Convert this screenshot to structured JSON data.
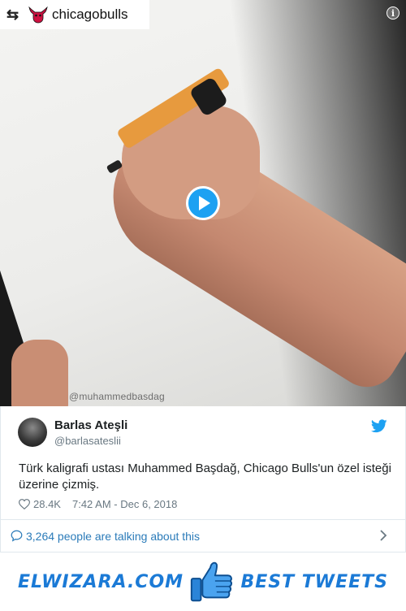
{
  "repost": {
    "account": "chicagobulls",
    "repost_icon": "retweet-icon",
    "logo_icon": "bull-logo-icon"
  },
  "media": {
    "watermark": "@muhammedbasdag",
    "play_icon": "play-icon",
    "info_icon": "info-icon"
  },
  "tweet": {
    "author_name": "Barlas Ateşli",
    "author_handle": "@barlasateslii",
    "text": "Türk kaligrafi ustası Muhammed Başdağ, Chicago Bulls'un özel isteği üzerine çizmiş.",
    "likes": "28.4K",
    "timestamp": "7:42 AM - Dec 6, 2018",
    "brand_icon": "twitter-bird-icon",
    "like_icon": "heart-icon"
  },
  "conversation": {
    "label": "3,264 people are talking about this",
    "icon": "speech-bubble-icon",
    "chevron": "chevron-right-icon"
  },
  "banner": {
    "left_text": "ELWIZARA.COM",
    "right_text": "BEST TWEETS",
    "icon": "thumbs-up-icon"
  },
  "colors": {
    "twitter_blue": "#1da1f2",
    "link_blue": "#2b7bb9",
    "banner_blue": "#1b7ad6",
    "muted_text": "#697882"
  }
}
